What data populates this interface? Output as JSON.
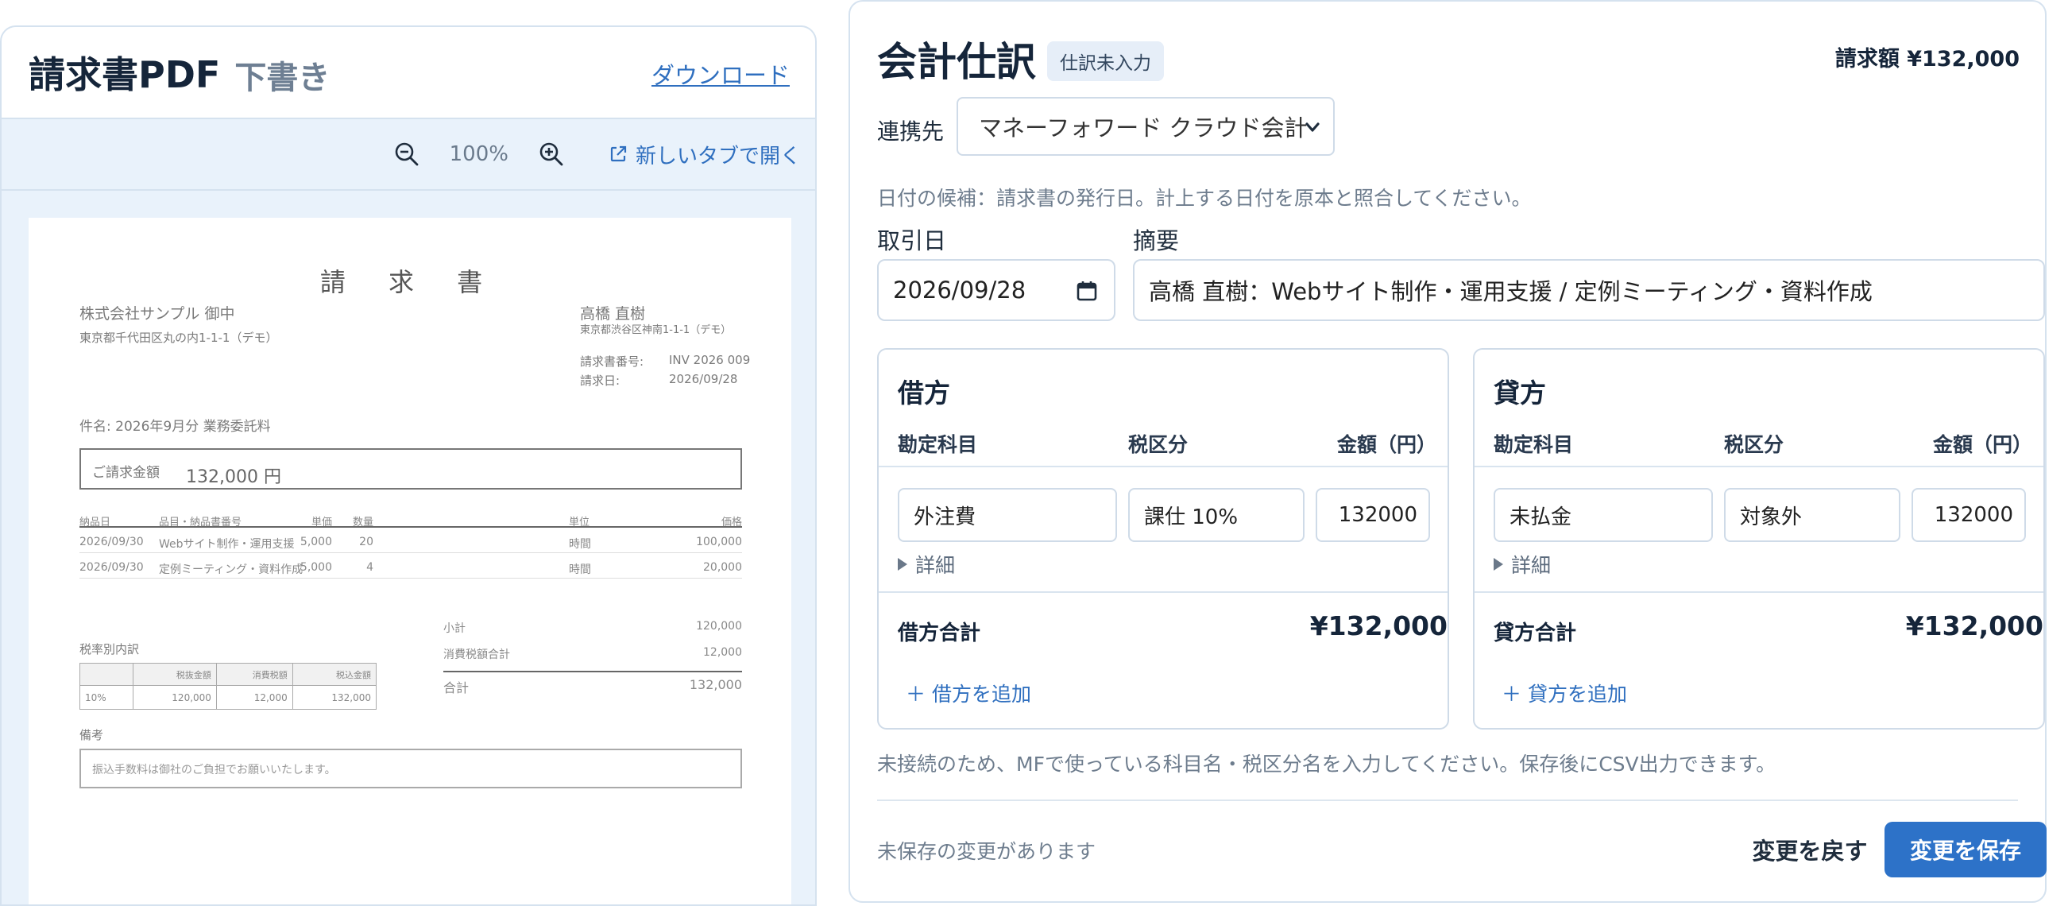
{
  "pdf_viewer": {
    "title": "請求書PDF",
    "status": "下書き",
    "download_label": "ダウンロード",
    "zoom_level": "100%",
    "open_new_tab_label": "新しいタブで開く"
  },
  "invoice": {
    "doc_title": "請 求 書",
    "recipient": "株式会社サンプル 御中",
    "recipient_address": "東京都千代田区丸の内1-1-1（デモ）",
    "issuer": "高橋 直樹",
    "issuer_address": "東京都渋谷区神南1-1-1（デモ）",
    "invoice_no_label": "請求書番号:",
    "invoice_no": "INV 2026 009",
    "date_label": "請求日:",
    "date": "2026/09/28",
    "subject": "件名: 2026年9月分 業務委託料",
    "amount_label": "ご請求金額",
    "amount": "132,000 円",
    "line_headers": [
      "納品日",
      "品目・納品書番号",
      "単価",
      "数量",
      "単位",
      "価格"
    ],
    "lines": [
      {
        "date": "2026/09/30",
        "item": "Webサイト制作・運用支援",
        "unit_price": "5,000",
        "qty": "20",
        "unit": "時間",
        "price": "100,000"
      },
      {
        "date": "2026/09/30",
        "item": "定例ミーティング・資料作成",
        "unit_price": "5,000",
        "qty": "4",
        "unit": "時間",
        "price": "20,000"
      }
    ],
    "tax_section_label": "税率別内訳",
    "tax_headers": [
      "",
      "税抜金額",
      "消費税額",
      "税込金額"
    ],
    "tax_row": [
      "10%",
      "120,000",
      "12,000",
      "132,000"
    ],
    "subtotal_label": "小計",
    "subtotal": "120,000",
    "tax_total_label": "消費税額合計",
    "tax_total": "12,000",
    "total_label": "合計",
    "total": "132,000",
    "remarks_label": "備考",
    "remarks": "振込手数料は御社のご負担でお願いいたします。"
  },
  "journal": {
    "title": "会計仕訳",
    "badge": "仕訳未入力",
    "amount": "請求額 ¥132,000",
    "link_label": "連携先",
    "link_value": "マネーフォワード クラウド会計",
    "hint": "日付の候補：請求書の発行日。計上する日付を原本と照合してください。",
    "date_label": "取引日",
    "date_value": "2026/09/28",
    "memo_label": "摘要",
    "memo_value": "高橋 直樹：Webサイト制作・運用支援 / 定例ミーティング・資料作成",
    "debit": {
      "title": "借方",
      "col_account": "勘定科目",
      "col_tax": "税区分",
      "col_amount": "金額（円）",
      "account": "外注費",
      "tax": "課仕 10%",
      "amount": "132000",
      "detail": "詳細",
      "sum_label": "借方合計",
      "sum_value": "¥132,000",
      "add_label": "＋ 借方を追加"
    },
    "credit": {
      "title": "貸方",
      "col_account": "勘定科目",
      "col_tax": "税区分",
      "col_amount": "金額（円）",
      "account": "未払金",
      "tax": "対象外",
      "amount": "132000",
      "detail": "詳細",
      "sum_label": "貸方合計",
      "sum_value": "¥132,000",
      "add_label": "＋ 貸方を追加"
    },
    "note": "未接続のため、MFで使っている科目名・税区分名を入力してください。保存後にCSV出力できます。",
    "unsaved": "未保存の変更があります",
    "revert_label": "変更を戻す",
    "save_label": "変更を保存"
  },
  "icons": {
    "zoom_out": "zoom-out-icon",
    "zoom_in": "zoom-in-icon",
    "external": "external-link-icon",
    "chevron": "chevron-down-icon",
    "calendar": "calendar-icon"
  },
  "colors": {
    "accent": "#2d72c8",
    "link": "#2f6fbf",
    "panel_bg": "#e9f2fb"
  }
}
